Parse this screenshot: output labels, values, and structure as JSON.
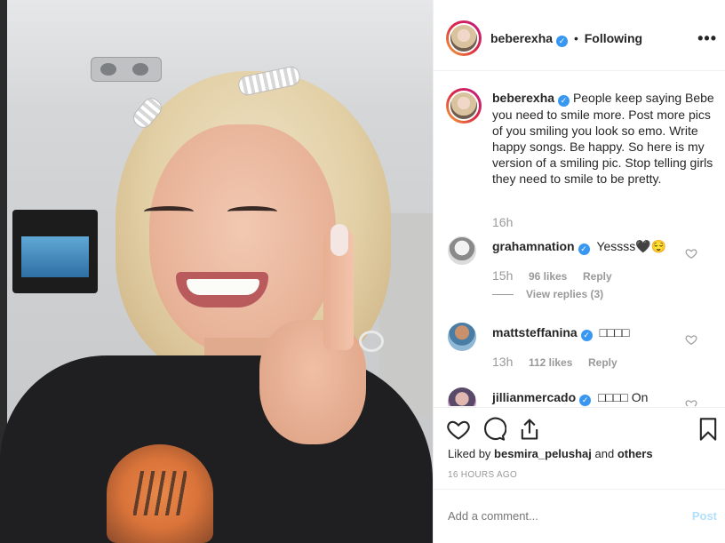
{
  "post": {
    "author": "beberexha",
    "follow_status": "Following",
    "separator": "•",
    "more_label": "•••",
    "verified_mark": "✓"
  },
  "caption": {
    "username": "beberexha",
    "text": "People keep saying Bebe you need to smile more. Post more pics of you smiling you look so emo. Write happy songs. Be happy. So here is my version of a smiling pic. Stop telling girls they need to smile to be pretty.",
    "age": "16h"
  },
  "comments": [
    {
      "username": "grahamnation",
      "text": "Yessss🖤😌",
      "age": "15h",
      "likes": "96 likes",
      "reply": "Reply",
      "view_replies": "View replies (3)"
    },
    {
      "username": "mattsteffanina",
      "text": "□□□□",
      "age": "13h",
      "likes": "112 likes",
      "reply": "Reply"
    },
    {
      "username": "jillianmercado",
      "text": "□□□□ On"
    }
  ],
  "actions": {
    "like_icon": "heart-icon",
    "comment_icon": "comment-bubble-icon",
    "share_icon": "share-icon",
    "save_icon": "bookmark-icon"
  },
  "likes": {
    "prefix": "Liked by",
    "user": "besmira_pelushaj",
    "and": "and",
    "others": "others"
  },
  "timestamp": "16 HOURS AGO",
  "add_comment": {
    "placeholder": "Add a comment...",
    "post_label": "Post"
  },
  "colors": {
    "verified": "#3897f0",
    "post_button_disabled": "#b2dffc",
    "muted_text": "#999999",
    "border": "#efefef"
  }
}
